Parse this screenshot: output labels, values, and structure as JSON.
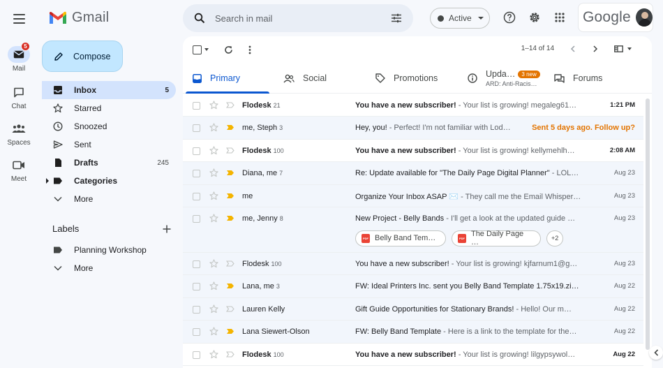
{
  "rail": {
    "items": [
      {
        "label": "Mail",
        "badge": "5"
      },
      {
        "label": "Chat"
      },
      {
        "label": "Spaces"
      },
      {
        "label": "Meet"
      }
    ]
  },
  "brand": {
    "name": "Gmail"
  },
  "compose": {
    "label": "Compose"
  },
  "nav": {
    "items": [
      {
        "label": "Inbox",
        "count": "5"
      },
      {
        "label": "Starred",
        "count": ""
      },
      {
        "label": "Snoozed",
        "count": ""
      },
      {
        "label": "Sent",
        "count": ""
      },
      {
        "label": "Drafts",
        "count": "245"
      },
      {
        "label": "Categories",
        "count": ""
      },
      {
        "label": "More",
        "count": ""
      }
    ]
  },
  "labels": {
    "title": "Labels",
    "items": [
      {
        "label": "Planning Workshop"
      },
      {
        "label": "More"
      }
    ]
  },
  "search": {
    "placeholder": "Search in mail"
  },
  "status": {
    "label": "Active"
  },
  "account": {
    "logo_text": "Google"
  },
  "toolbar": {
    "pager": "1–14 of 14"
  },
  "tabs": [
    {
      "label": "Primary",
      "sub": ""
    },
    {
      "label": "Social",
      "sub": ""
    },
    {
      "label": "Promotions",
      "sub": ""
    },
    {
      "label": "Upda…",
      "badge": "3 new",
      "sub": "ARD: Anti-Racis…"
    },
    {
      "label": "Forums",
      "sub": ""
    }
  ],
  "emails": [
    {
      "sender": "Flodesk",
      "count": "21",
      "subject": "You have a new subscriber!",
      "snippet": " - Your list is growing! megaleg61…",
      "date": "1:21 PM"
    },
    {
      "sender": "me, Steph",
      "count": "3",
      "subject": "Hey, you!",
      "snippet": " - Perfect! I'm not familiar with Lod…",
      "date": "Sent 5 days ago. Follow up?"
    },
    {
      "sender": "Flodesk",
      "count": "100",
      "subject": "You have a new subscriber!",
      "snippet": " - Your list is growing! kellymehlh…",
      "date": "2:08 AM"
    },
    {
      "sender": "Diana, me",
      "count": "7",
      "subject": "Re: Update available for \"The Daily Page Digital Planner\"",
      "snippet": " - LOL…",
      "date": "Aug 23"
    },
    {
      "sender": "me",
      "count": "",
      "subject": "Organize Your Inbox ASAP ✉️",
      "snippet": " - They call me the Email Whisper…",
      "date": "Aug 23"
    },
    {
      "sender": "me, Jenny",
      "count": "8",
      "subject": "New Project - Belly Bands",
      "snippet": " - I'll get a look at the updated guide …",
      "date": "Aug 23",
      "chips": [
        "Belly Band Tem…",
        "The Daily Page …"
      ],
      "more": "+2"
    },
    {
      "sender": "Flodesk",
      "count": "100",
      "subject": "You have a new subscriber!",
      "snippet": " - Your list is growing! kjfarnum1@g…",
      "date": "Aug 23"
    },
    {
      "sender": "Lana, me",
      "count": "3",
      "subject": "FW: Ideal Printers Inc. sent you Belly Band Template 1.75x19.zip",
      "snippet": " …",
      "date": "Aug 22"
    },
    {
      "sender": "Lauren Kelly",
      "count": "",
      "subject": "Gift Guide Opportunities for Stationary Brands!",
      "snippet": " - Hello! Our m…",
      "date": "Aug 22"
    },
    {
      "sender": "Lana Siewert-Olson",
      "count": "",
      "subject": "FW: Belly Band Template",
      "snippet": " - Here is a link to the template for the…",
      "date": "Aug 22"
    },
    {
      "sender": "Flodesk",
      "count": "100",
      "subject": "You have a new subscriber!",
      "snippet": " - Your list is growing! lilgypsywol…",
      "date": "Aug 22"
    }
  ],
  "colors": {
    "accent": "#0b57d0",
    "compose_bg": "#c2e7ff",
    "active_nav": "#d3e3fd",
    "important": "#f4b400",
    "followup": "#e37400"
  }
}
